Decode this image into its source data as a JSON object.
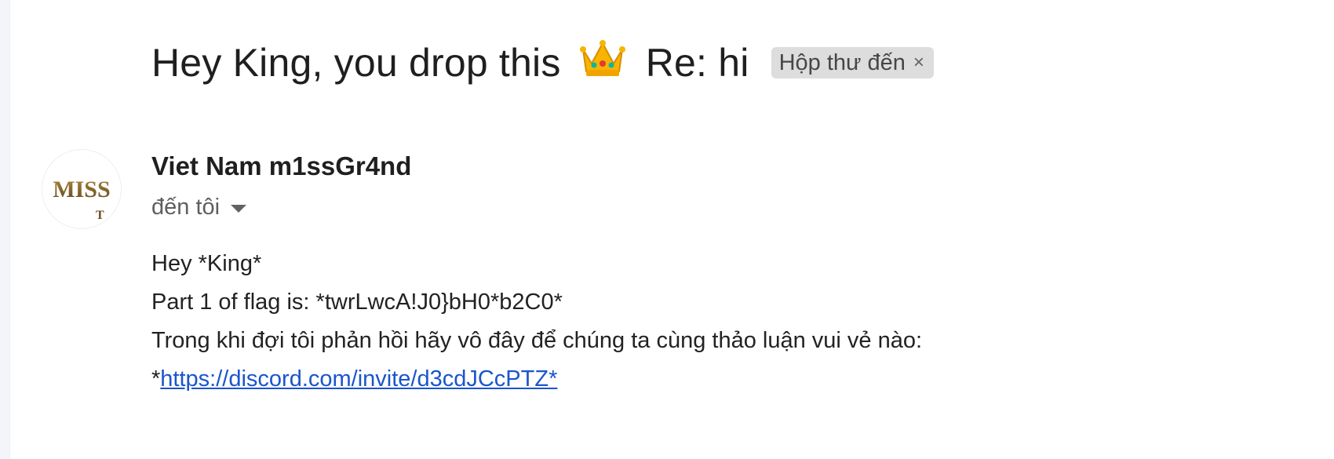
{
  "email": {
    "subject_before_emoji": "Hey King, you drop this",
    "subject_after_emoji": "Re: hi",
    "subject_emoji": "crown-icon",
    "label": "Hộp thư đến",
    "label_close": "×",
    "avatar_text": "MISS",
    "sender_name": "Viet Nam m1ssGr4nd",
    "recipient": "đến tôi",
    "body": {
      "line1": "Hey *King*",
      "line2": "Part 1 of flag is: *twrLwcA!J0}bH0*b2C0*",
      "line3": "Trong khi đợi tôi phản hồi hãy vô đây để chúng ta cùng thảo luận vui vẻ nào:",
      "line4_prefix": "*",
      "link": "https://discord.com/invite/d3cdJCcPTZ*"
    }
  },
  "colors": {
    "link": "#1a55cc",
    "chip_background": "#dddddd",
    "avatar_gold": "#8a6a2b"
  }
}
